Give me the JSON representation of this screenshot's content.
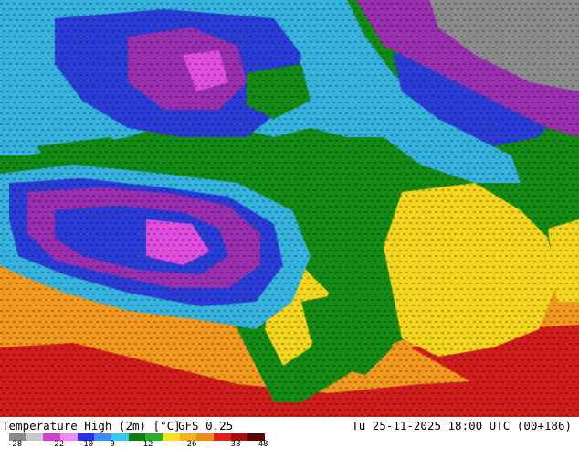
{
  "map": {
    "description_icon": "temperature-map",
    "colors": {
      "ocean_warm": "#f29a1e",
      "ocean_hot": "#d21d1d",
      "land_green": "#138b14",
      "land_cyan": "#36b4e0",
      "land_blue": "#2a3dd8",
      "land_purple": "#9a2fb0",
      "land_magenta": "#e04de0",
      "land_yellow": "#f5d61f",
      "cold_gray": "#8c8c8c"
    }
  },
  "footer": {
    "title": "Temperature High (2m) [°C]",
    "model": "GFS 0.25",
    "valid": "Tu 25-11-2025 18:00 UTC (00+186)"
  },
  "scale": {
    "segments": [
      {
        "color": "#8a8a8a",
        "weight": 1
      },
      {
        "color": "#c8c8c8",
        "weight": 1
      },
      {
        "color": "#d23fd2",
        "weight": 1
      },
      {
        "color": "#ee8bee",
        "weight": 1
      },
      {
        "color": "#2d2de8",
        "weight": 1
      },
      {
        "color": "#3f8cf5",
        "weight": 1
      },
      {
        "color": "#36c8f0",
        "weight": 1
      },
      {
        "color": "#0f7f0f",
        "weight": 1
      },
      {
        "color": "#29b129",
        "weight": 1
      },
      {
        "color": "#f5e21f",
        "weight": 1
      },
      {
        "color": "#f5b21f",
        "weight": 1
      },
      {
        "color": "#f08a14",
        "weight": 1
      },
      {
        "color": "#e0211a",
        "weight": 1
      },
      {
        "color": "#a80f0f",
        "weight": 1
      },
      {
        "color": "#5a0606",
        "weight": 1
      }
    ],
    "ticks": [
      "-28",
      "-22",
      "-10",
      "0",
      "12",
      "26",
      "38",
      "48"
    ]
  }
}
